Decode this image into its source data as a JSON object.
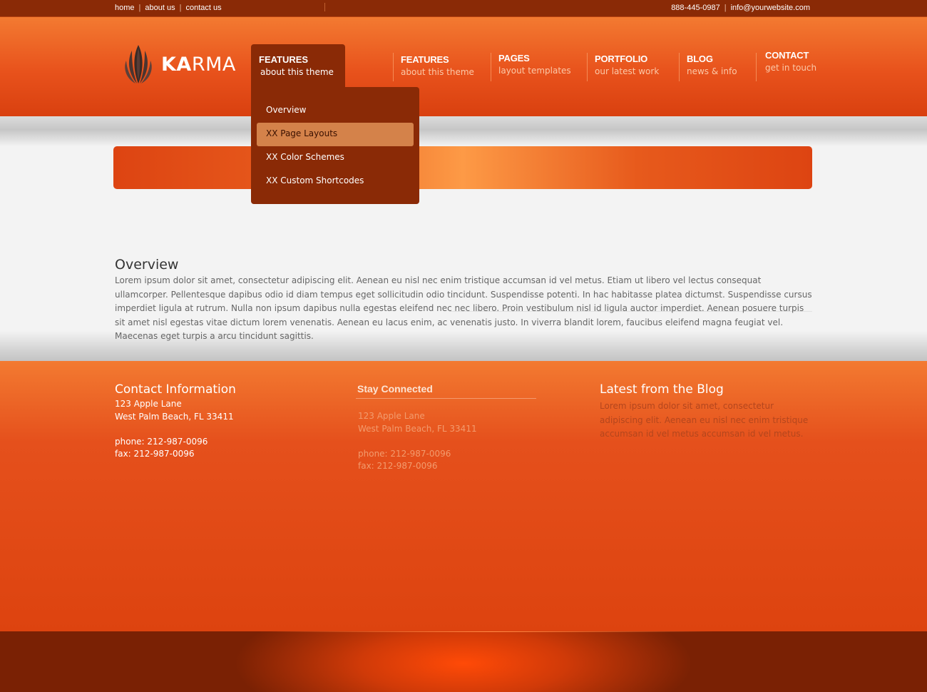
{
  "topbar": {
    "links": [
      "home",
      "about us",
      "contact us"
    ],
    "phone": "888-445-0987",
    "email": "info@yourwebsite.com",
    "separator": "|"
  },
  "logo": {
    "bold": "KA",
    "rest": "RMA"
  },
  "nav": {
    "active": {
      "title": "FEATURES",
      "sub": "about this theme"
    },
    "items": [
      {
        "title": "FEATURES",
        "sub": "about this theme"
      },
      {
        "title": "PAGES",
        "sub": "layout templates"
      },
      {
        "title": "PORTFOLIO",
        "sub": "our latest work"
      },
      {
        "title": "BLOG",
        "sub": "news & info"
      },
      {
        "title": "CONTACT",
        "sub": "get in touch"
      }
    ]
  },
  "dropdown": {
    "items": [
      "Overview",
      "XX Page Layouts",
      "XX Color Schemes",
      "XX Custom Shortcodes"
    ],
    "highlighted_index": 1
  },
  "content": {
    "title": "Overview",
    "body": "Lorem ipsum dolor sit amet, consectetur adipiscing elit. Aenean eu nisl nec enim tristique accumsan id vel metus. Etiam ut libero vel lectus consequat ullamcorper. Pellentesque dapibus odio id diam tempus eget sollicitudin odio tincidunt. Suspendisse potenti. In hac habitasse platea dictumst. Suspendisse cursus imperdiet ligula at rutrum. Nulla non ipsum dapibus nulla egestas eleifend nec nec libero. Proin vestibulum nisl id ligula auctor imperdiet. Aenean posuere turpis sit amet nisl egestas vitae dictum lorem venenatis. Aenean eu lacus enim, ac venenatis justo. In viverra blandit lorem, faucibus eleifend magna feugiat vel. Maecenas eget turpis a arcu tincidunt sagittis."
  },
  "footer": {
    "contact": {
      "title": "Contact Information",
      "address1": "123 Apple Lane",
      "address2": "West Palm Beach, FL 33411",
      "phone": "phone: 212-987-0096",
      "fax": "fax: 212-987-0096"
    },
    "stay": {
      "title": "Stay Connected",
      "address1": "123 Apple Lane",
      "address2": "West Palm Beach, FL 33411",
      "phone": "phone: 212-987-0096",
      "fax": "fax: 212-987-0096"
    },
    "blog": {
      "title": "Latest from the Blog",
      "text": "Lorem ipsum dolor sit amet, consectetur adipiscing elit. Aenean eu nisl nec enim tristique accumsan id vel metus accumsan id vel metus."
    }
  },
  "colors": {
    "brand_orange": "#e8521c",
    "dark_rust": "#8a2a06",
    "highlight": "#d4824a"
  }
}
